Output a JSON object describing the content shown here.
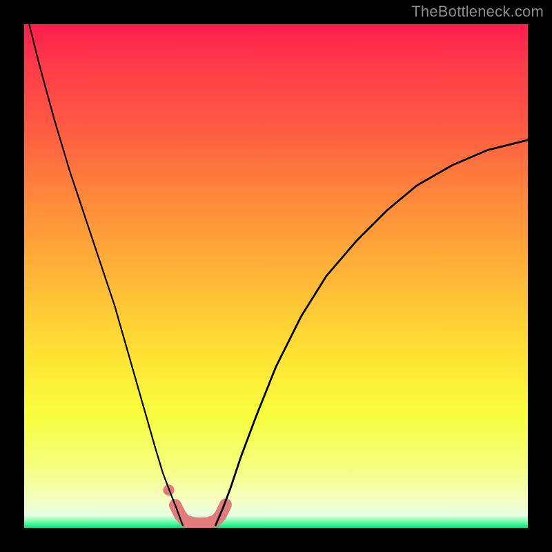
{
  "watermark": "TheBottleneck.com",
  "chart_data": {
    "type": "line",
    "title": "",
    "xlabel": "",
    "ylabel": "",
    "xlim": [
      0,
      100
    ],
    "ylim": [
      0,
      100
    ],
    "grid": false,
    "series": [
      {
        "name": "left-curve",
        "x": [
          1,
          3,
          6,
          9,
          12,
          15,
          18,
          20,
          22,
          24,
          26,
          27.5,
          29,
          30.2,
          31.1,
          31.5
        ],
        "y": [
          100,
          92,
          81,
          71,
          62,
          53,
          44,
          37,
          30,
          23,
          16,
          11,
          7,
          4,
          1.5,
          0.5
        ]
      },
      {
        "name": "right-curve",
        "x": [
          38,
          39.5,
          41,
          43,
          46,
          50,
          55,
          60,
          66,
          72,
          78,
          85,
          92,
          100
        ],
        "y": [
          0.5,
          4,
          8,
          14,
          22,
          32,
          42,
          50,
          57,
          63,
          68,
          72,
          75,
          77
        ]
      },
      {
        "name": "accent-bottom-band",
        "x": [
          30,
          31,
          32,
          33.5,
          35,
          36.5,
          38,
          39,
          40
        ],
        "y": [
          4.5,
          2.5,
          1.4,
          0.9,
          0.8,
          0.9,
          1.4,
          2.5,
          4.6
        ]
      },
      {
        "name": "accent-dot",
        "x": [
          28.7
        ],
        "y": [
          7.5
        ]
      }
    ],
    "background": {
      "type": "vertical-gradient",
      "stops": [
        {
          "pos": 0.0,
          "color": "#ff1d4d"
        },
        {
          "pos": 0.08,
          "color": "#ff3b4a"
        },
        {
          "pos": 0.2,
          "color": "#ff5943"
        },
        {
          "pos": 0.35,
          "color": "#ff8a3a"
        },
        {
          "pos": 0.5,
          "color": "#ffb638"
        },
        {
          "pos": 0.65,
          "color": "#ffe133"
        },
        {
          "pos": 0.78,
          "color": "#f7ff3e"
        },
        {
          "pos": 0.88,
          "color": "#f3ff7e"
        },
        {
          "pos": 0.95,
          "color": "#f5ffc8"
        },
        {
          "pos": 0.975,
          "color": "#e9ffe2"
        },
        {
          "pos": 0.985,
          "color": "#8cffb6"
        },
        {
          "pos": 1.0,
          "color": "#00e77d"
        }
      ]
    },
    "colors": {
      "curve": "#000000",
      "accent": "#e07c7c",
      "frame": "#000000"
    }
  }
}
